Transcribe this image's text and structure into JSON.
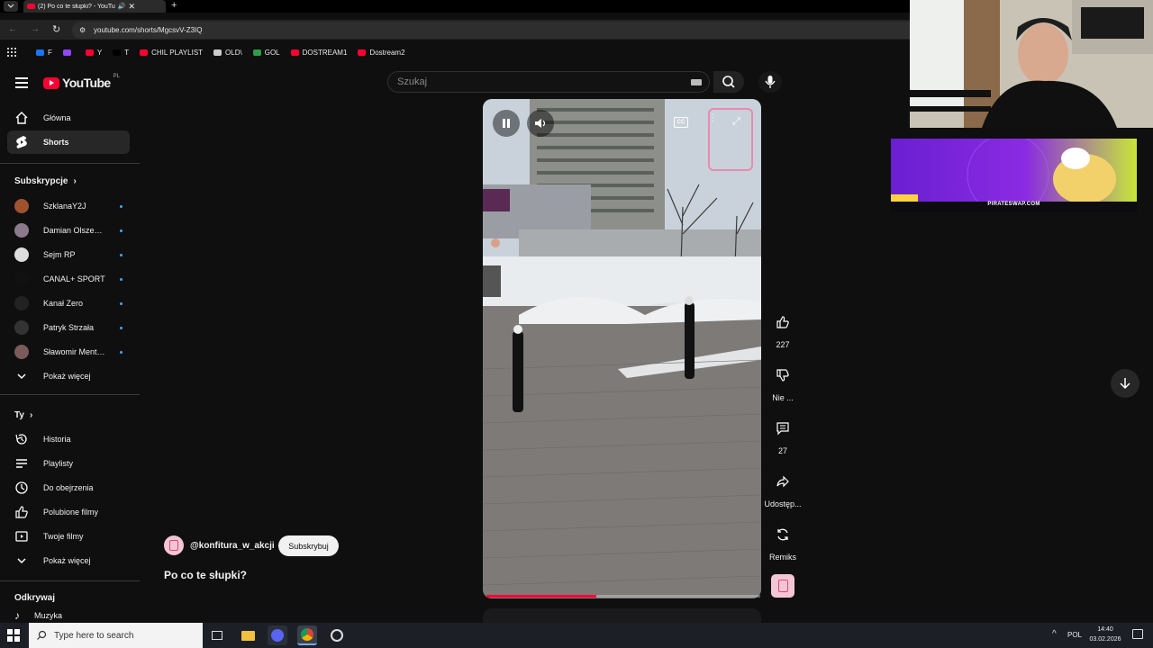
{
  "browser": {
    "tab_title": "(2) Po co te słupki? - YouTu",
    "url": "youtube.com/shorts/MgcsvV-Z3IQ",
    "bookmarks": [
      {
        "label": "F",
        "icon": "facebook-icon",
        "color": "#1877f2"
      },
      {
        "label": "",
        "icon": "twitch-icon",
        "color": "#9146ff"
      },
      {
        "label": "Y",
        "icon": "youtube-icon",
        "color": "#ff0033"
      },
      {
        "label": "T",
        "icon": "x-icon",
        "color": "#000000"
      },
      {
        "label": "CHIL PLAYLIST",
        "icon": "youtube-icon",
        "color": "#ff0033"
      },
      {
        "label": "OLD\\",
        "icon": "folder-icon",
        "color": "#cccccc"
      },
      {
        "label": "GOL",
        "icon": "gol-icon",
        "color": "#2e9d4b"
      },
      {
        "label": "DOSTREAM1",
        "icon": "youtube-icon",
        "color": "#ff0033"
      },
      {
        "label": "Dostream2",
        "icon": "youtube-icon",
        "color": "#ff0033"
      }
    ]
  },
  "youtube": {
    "logo_text": "YouTube",
    "logo_region": "PL",
    "search_placeholder": "Szukaj",
    "nav": [
      {
        "label": "Główna",
        "icon": "home-icon"
      },
      {
        "label": "Shorts",
        "icon": "shorts-icon",
        "active": true
      }
    ],
    "subscriptions_title": "Subskrypcje",
    "subscriptions": [
      {
        "name": "SzklanaY2J",
        "color": "#a0522d"
      },
      {
        "name": "Damian Olszews...",
        "color": "#8a7a8c"
      },
      {
        "name": "Sejm RP",
        "color": "#dddddd"
      },
      {
        "name": "CANAL+ SPORT",
        "color": "#111111"
      },
      {
        "name": "Kanał Zero",
        "color": "#222222"
      },
      {
        "name": "Patryk Strzała",
        "color": "#333333"
      },
      {
        "name": "Sławomir Mentz...",
        "color": "#7a5a5a"
      }
    ],
    "show_more": "Pokaż więcej",
    "you_title": "Ty",
    "you_items": [
      {
        "label": "Historia",
        "icon": "history-icon"
      },
      {
        "label": "Playlisty",
        "icon": "playlist-icon"
      },
      {
        "label": "Do obejrzenia",
        "icon": "clock-icon"
      },
      {
        "label": "Polubione filmy",
        "icon": "thumbs-up-icon"
      },
      {
        "label": "Twoje filmy",
        "icon": "video-icon"
      }
    ],
    "you_show_more": "Pokaż więcej",
    "explore_title": "Odkrywaj",
    "explore_first": "Muzyka"
  },
  "short": {
    "channel": "@konfitura_w_akcji",
    "subscribe_label": "Subskrybuj",
    "title": "Po co te słupki?",
    "likes": "227",
    "dislike_label": "Nie ...",
    "comments": "27",
    "share_label": "Udostęp...",
    "remix_label": "Remiks",
    "cc_label": "CC",
    "progress": 0.4
  },
  "overlay": {
    "ad_text": "PIRATESWAP.COM"
  },
  "taskbar": {
    "search_placeholder": "Type here to search",
    "language": "POL",
    "time": "14:40",
    "date": "03.02.2026"
  }
}
